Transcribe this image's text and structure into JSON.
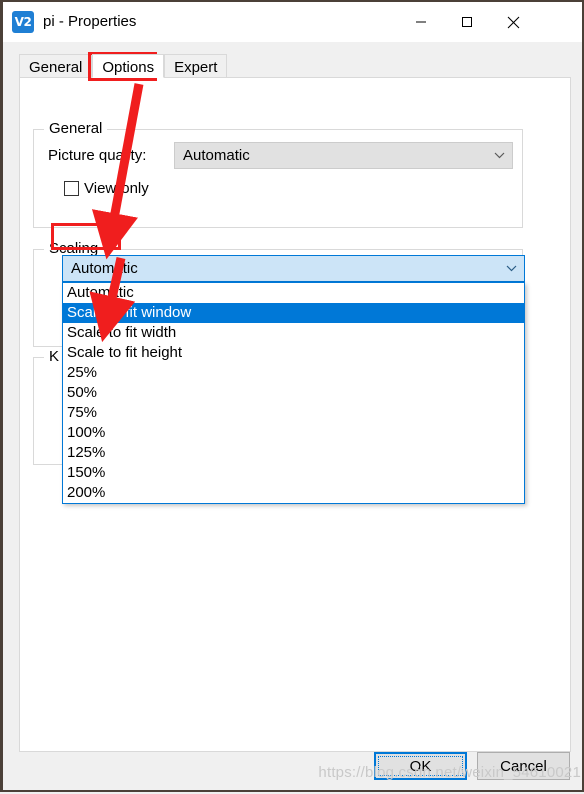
{
  "window": {
    "title": "pi - Properties",
    "icon": "vnc-viewer-icon",
    "icon_glyph": "V2",
    "controls": {
      "minimize": "Minimize",
      "maximize": "Maximize",
      "close": "Close"
    }
  },
  "tabs": [
    {
      "label": "General",
      "active": false
    },
    {
      "label": "Options",
      "active": true
    },
    {
      "label": "Expert",
      "active": false
    }
  ],
  "groups": {
    "general": {
      "title": "General",
      "picture_quality_label": "Picture quality:",
      "picture_quality_value": "Automatic",
      "view_only_label": "View-only",
      "view_only_checked": false
    },
    "scaling": {
      "title": "Scaling",
      "selected_value": "Automatic",
      "options": [
        "Automatic",
        "Scale to fit window",
        "Scale to fit width",
        "Scale to fit height",
        "25%",
        "50%",
        "75%",
        "100%",
        "125%",
        "150%",
        "200%"
      ],
      "highlighted_option": "Scale to fit window"
    },
    "keyboard": {
      "title": "K"
    }
  },
  "buttons": {
    "ok": "OK",
    "cancel": "Cancel"
  },
  "watermark": "https://blog.csdn.net/weixin_54610021",
  "colors": {
    "accent": "#0078d7",
    "annotation": "#f01e1e",
    "combo_open_bg": "#cce4f7",
    "combo_disabled_bg": "#e1e1e1",
    "window_border": "#4b4038"
  }
}
